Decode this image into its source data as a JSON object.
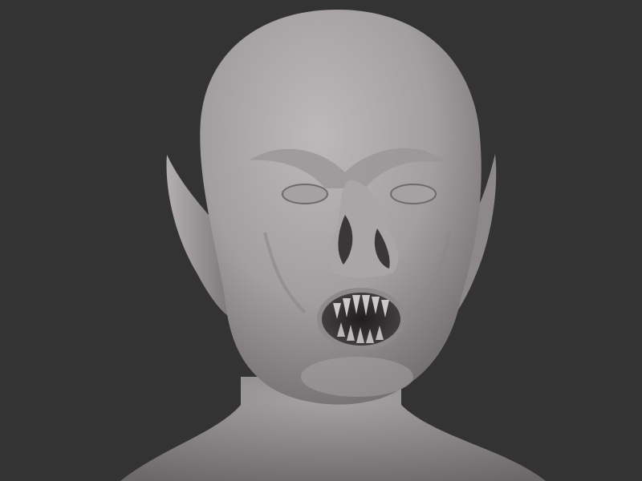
{
  "scene": {
    "subject": "sculpted-creature-bust",
    "colors": {
      "background": "#333333",
      "clay_light": "#b7b3b4",
      "clay_mid": "#8f8b8c",
      "clay_dark": "#5d5a5b",
      "mouth_cavity": "#2e2b2c",
      "teeth": "#cfcbcc"
    }
  }
}
